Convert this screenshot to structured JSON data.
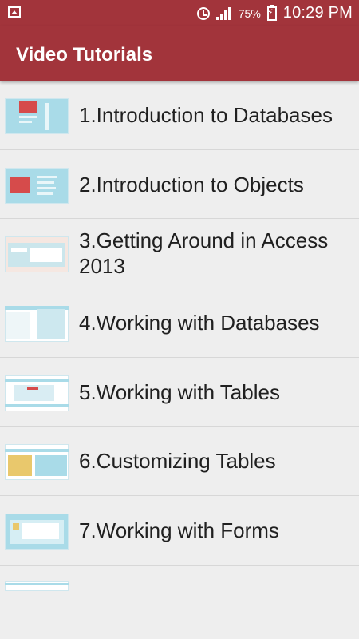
{
  "status": {
    "battery": "75%",
    "time": "10:29 PM"
  },
  "app_bar": {
    "title": "Video Tutorials"
  },
  "items": [
    {
      "label": "1.Introduction to Databases"
    },
    {
      "label": "2.Introduction to Objects"
    },
    {
      "label": "3.Getting Around in Access 2013"
    },
    {
      "label": "4.Working with Databases"
    },
    {
      "label": "5.Working with Tables"
    },
    {
      "label": "6.Customizing Tables"
    },
    {
      "label": "7.Working with Forms"
    }
  ],
  "colors": {
    "primary": "#a2343b",
    "background": "#eeeeee"
  }
}
